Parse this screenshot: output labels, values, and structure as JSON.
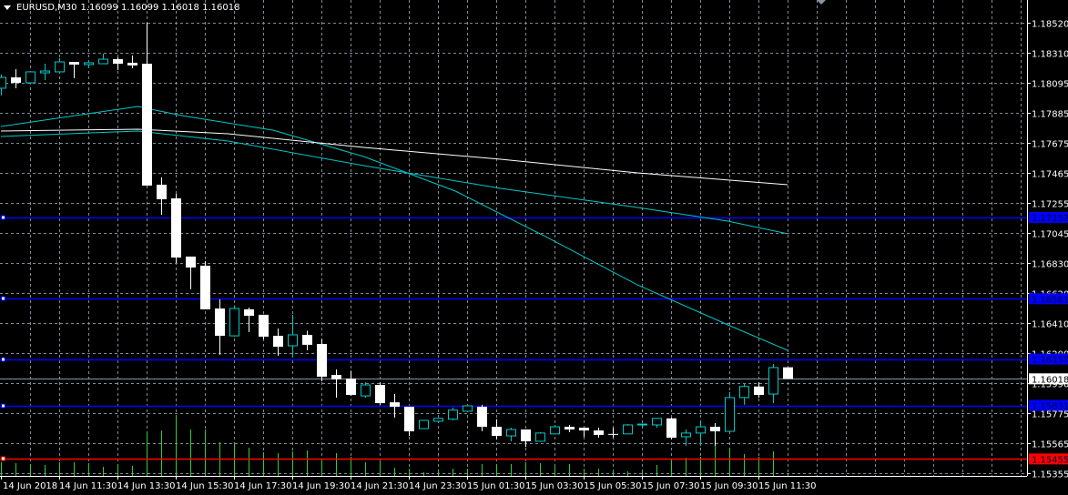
{
  "header": {
    "symbol": "EURUSD,M30",
    "ohlc": "1.16099 1.16099 1.16018 1.16018",
    "menu_icon": "triangle-down-icon"
  },
  "colors": {
    "background": "#000000",
    "grid": "#7f8c99",
    "bull": "#00c8c8",
    "bear": "#ffffff",
    "volume": "#33cc33",
    "ma_fast": "#00c8c8",
    "ma_mid": "#00c8c8",
    "ma_slow": "#ffffff",
    "hline_blue": "#0000ff",
    "hline_red": "#ff0000",
    "current_price": "#8a949e"
  },
  "chart_data": {
    "type": "candlestick",
    "timeframe": "M30",
    "ylim": [
      1.15355,
      1.1852
    ],
    "grid": true,
    "y_ticks": [
      "1.18520",
      "1.18310",
      "1.18095",
      "1.17885",
      "1.17675",
      "1.17465",
      "1.17255",
      "1.17045",
      "1.16830",
      "1.16620",
      "1.16410",
      "1.16200",
      "1.15990",
      "1.15775",
      "1.15565",
      "1.15355"
    ],
    "x_labels": [
      "14 Jun 2018",
      "14 Jun 11:30",
      "14 Jun 13:30",
      "14 Jun 15:30",
      "14 Jun 17:30",
      "14 Jun 19:30",
      "14 Jun 21:30",
      "14 Jun 23:30",
      "15 Jun 01:30",
      "15 Jun 03:30",
      "15 Jun 05:30",
      "15 Jun 07:30",
      "15 Jun 09:30",
      "15 Jun 11:30"
    ],
    "candles": [
      [
        1.1806,
        1.18156,
        1.18009,
        1.18136
      ],
      [
        1.18136,
        1.18194,
        1.1806,
        1.18098
      ],
      [
        1.18098,
        1.18175,
        1.18092,
        1.18175
      ],
      [
        1.18168,
        1.18232,
        1.18117,
        1.18181
      ],
      [
        1.18175,
        1.18271,
        1.18175,
        1.18245
      ],
      [
        1.18245,
        1.18245,
        1.1813,
        1.18226
      ],
      [
        1.18226,
        1.18251,
        1.182,
        1.18239
      ],
      [
        1.18232,
        1.18303,
        1.18232,
        1.18264
      ],
      [
        1.18264,
        1.18277,
        1.18188,
        1.18232
      ],
      [
        1.18239,
        1.1829,
        1.182,
        1.1822
      ],
      [
        1.18232,
        1.1852,
        1.17376,
        1.17376
      ],
      [
        1.17382,
        1.17433,
        1.17171,
        1.1728
      ],
      [
        1.17286,
        1.17318,
        1.16832,
        1.1687
      ],
      [
        1.16877,
        1.16877,
        1.16647,
        1.168
      ],
      [
        1.16813,
        1.16845,
        1.16506,
        1.16506
      ],
      [
        1.16512,
        1.16576,
        1.16187,
        1.1632
      ],
      [
        1.1632,
        1.16535,
        1.16314,
        1.16512
      ],
      [
        1.16506,
        1.16519,
        1.16346,
        1.16461
      ],
      [
        1.16468,
        1.16468,
        1.16296,
        1.16314
      ],
      [
        1.1632,
        1.16372,
        1.1618,
        1.16243
      ],
      [
        1.1625,
        1.16468,
        1.16167,
        1.16327
      ],
      [
        1.16327,
        1.16356,
        1.16218,
        1.16257
      ],
      [
        1.16263,
        1.16298,
        1.16001,
        1.16033
      ],
      [
        1.16045,
        1.16084,
        1.15886,
        1.16014
      ],
      [
        1.1602,
        1.16075,
        1.15898,
        1.15905
      ],
      [
        1.15898,
        1.15994,
        1.15886,
        1.15975
      ],
      [
        1.15975,
        1.15994,
        1.15835,
        1.15847
      ],
      [
        1.15853,
        1.15911,
        1.15745,
        1.15822
      ],
      [
        1.15822,
        1.15822,
        1.15617,
        1.15649
      ],
      [
        1.15668,
        1.15726,
        1.15668,
        1.15726
      ],
      [
        1.1572,
        1.1574,
        1.1572,
        1.1574
      ],
      [
        1.15734,
        1.15815,
        1.15726,
        1.15798
      ],
      [
        1.1579,
        1.15835,
        1.1579,
        1.15828
      ],
      [
        1.15822,
        1.15835,
        1.15649,
        1.15681
      ],
      [
        1.15681,
        1.15734,
        1.15592,
        1.15617
      ],
      [
        1.15617,
        1.15675,
        1.15579,
        1.15662
      ],
      [
        1.15662,
        1.15662,
        1.1554,
        1.15579
      ],
      [
        1.15579,
        1.15643,
        1.15579,
        1.15637
      ],
      [
        1.15631,
        1.15694,
        1.15631,
        1.15681
      ],
      [
        1.15681,
        1.15694,
        1.15643,
        1.15662
      ],
      [
        1.15675,
        1.15675,
        1.15611,
        1.15655
      ],
      [
        1.15655,
        1.15675,
        1.15604,
        1.15624
      ],
      [
        1.15631,
        1.15675,
        1.15604,
        1.15631
      ],
      [
        1.15631,
        1.157,
        1.15631,
        1.15694
      ],
      [
        1.15694,
        1.157,
        1.15675,
        1.157
      ],
      [
        1.15694,
        1.1574,
        1.15675,
        1.1574
      ],
      [
        1.1574,
        1.15745,
        1.15592,
        1.15604
      ],
      [
        1.15611,
        1.15662,
        1.15547,
        1.15637
      ],
      [
        1.15637,
        1.15726,
        1.15547,
        1.15681
      ],
      [
        1.15681,
        1.15707,
        1.15547,
        1.15649
      ],
      [
        1.15649,
        1.15924,
        1.15649,
        1.15886
      ],
      [
        1.15886,
        1.15982,
        1.15835,
        1.15964
      ],
      [
        1.15964,
        1.15994,
        1.15886,
        1.15905
      ],
      [
        1.15911,
        1.16122,
        1.15847,
        1.16097
      ],
      [
        1.16099,
        1.16099,
        1.16018,
        1.16018
      ]
    ],
    "volume": [
      15,
      14,
      13,
      12,
      15,
      15,
      14,
      10,
      13,
      11,
      49,
      50,
      67,
      51,
      51,
      37,
      36,
      31,
      26,
      25,
      27,
      28,
      19,
      25,
      21,
      15,
      16,
      9,
      8,
      4,
      7,
      8,
      8,
      13,
      12,
      13,
      15,
      14,
      11,
      13,
      8,
      8,
      6,
      5,
      5,
      12,
      18,
      20,
      21,
      34,
      31,
      24,
      21,
      27,
      2
    ],
    "moving_averages": [
      {
        "role": "fast",
        "points": [
          [
            0,
            1.17791
          ],
          [
            9.4,
            1.17932
          ],
          [
            12.4,
            1.17868
          ],
          [
            18.7,
            1.17765
          ],
          [
            24.9,
            1.1758
          ],
          [
            31.2,
            1.17337
          ],
          [
            37.4,
            1.17017
          ],
          [
            43.7,
            1.16678
          ],
          [
            49.9,
            1.16397
          ],
          [
            54,
            1.16218
          ]
        ]
      },
      {
        "role": "mid",
        "points": [
          [
            0,
            1.17721
          ],
          [
            9.4,
            1.17759
          ],
          [
            15.6,
            1.17689
          ],
          [
            24.9,
            1.17516
          ],
          [
            34.3,
            1.17356
          ],
          [
            43.7,
            1.17222
          ],
          [
            49.9,
            1.17126
          ],
          [
            54,
            1.17037
          ]
        ]
      },
      {
        "role": "slow",
        "points": [
          [
            0,
            1.17759
          ],
          [
            9.4,
            1.17772
          ],
          [
            15.6,
            1.1774
          ],
          [
            24.9,
            1.17644
          ],
          [
            34.3,
            1.17561
          ],
          [
            43.7,
            1.17465
          ],
          [
            54,
            1.17382
          ]
        ]
      }
    ],
    "horizontal_lines": [
      {
        "price": "1.17152",
        "color": "blue",
        "drawn": false
      },
      {
        "price": "1.16581",
        "color": "blue",
        "drawn": true
      },
      {
        "price": "1.16157",
        "color": "blue",
        "drawn": false
      },
      {
        "price": "1.15831",
        "color": "blue",
        "drawn": true
      },
      {
        "price": "1.15455",
        "color": "red",
        "drawn": false
      }
    ],
    "current_price": "1.16018"
  }
}
